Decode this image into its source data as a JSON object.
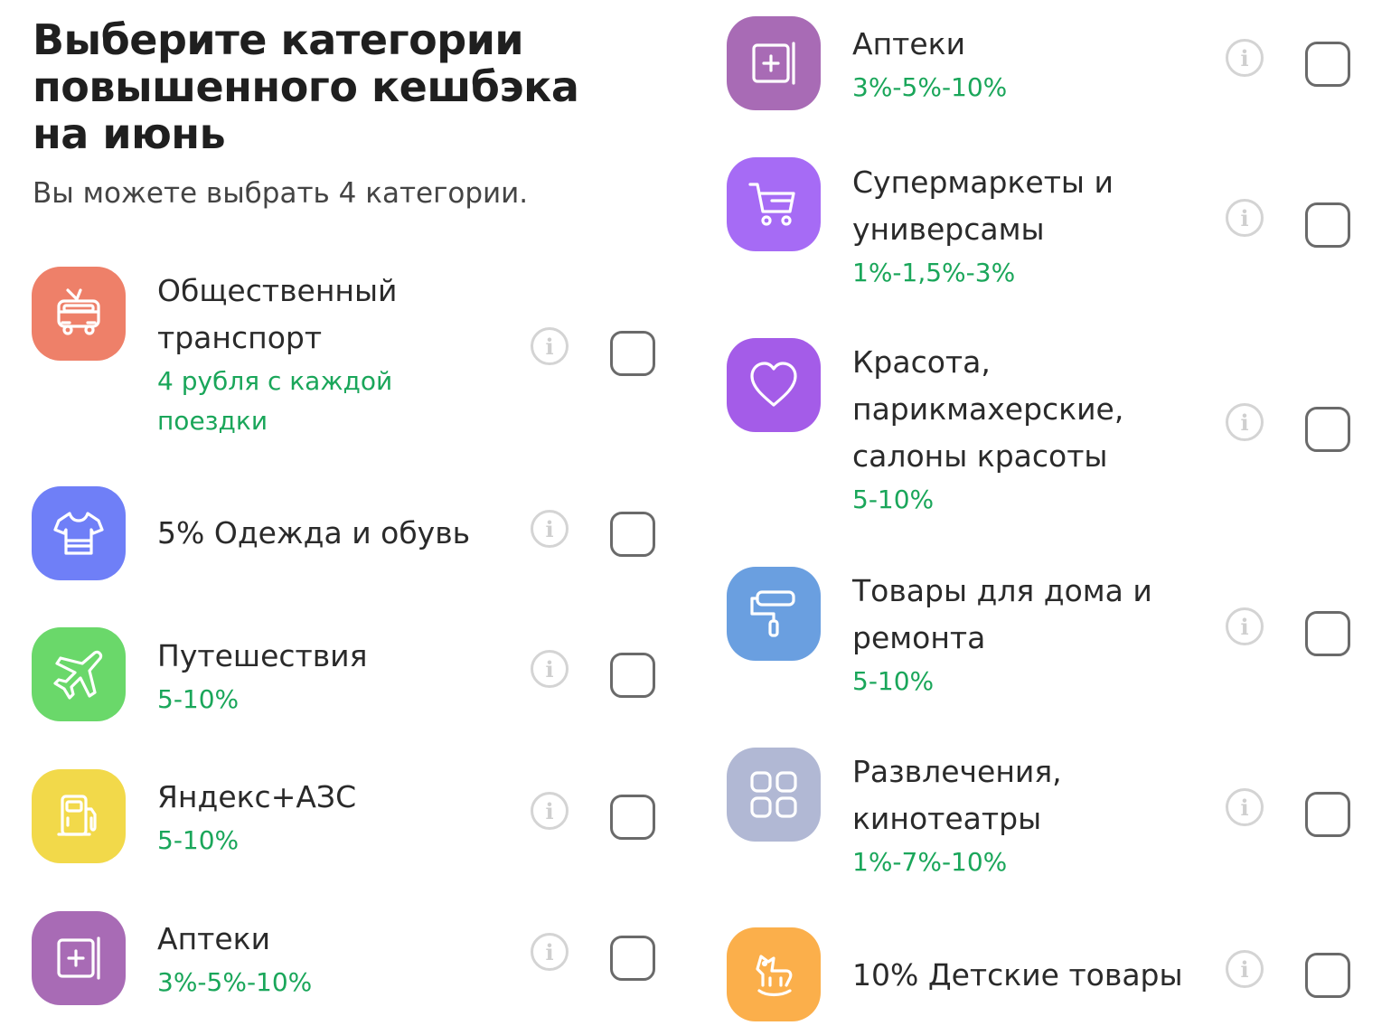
{
  "header": {
    "title": "Выберите категории повышенного кешбэка на июнь",
    "subtitle": "Вы можете выбрать 4 категории."
  },
  "left_items": [
    {
      "name": "Общественный транспорт",
      "rate": "4 рубля с каждой поездки",
      "icon": "trolleybus-icon",
      "color": "#EE8069"
    },
    {
      "name": "5% Одежда и обувь",
      "rate": "",
      "icon": "tshirt-icon",
      "color": "#6F7FF7"
    },
    {
      "name": "Путешествия",
      "rate": "5-10%",
      "icon": "airplane-icon",
      "color": "#6AD86A"
    },
    {
      "name": "Яндекс+АЗС",
      "rate": "5-10%",
      "icon": "fuel-pump-icon",
      "color": "#F2D94A"
    },
    {
      "name": "Аптеки",
      "rate": "3%-5%-10%",
      "icon": "pharmacy-icon",
      "color": "#A86BB5"
    }
  ],
  "right_items": [
    {
      "name": "Аптеки",
      "rate": "3%-5%-10%",
      "icon": "pharmacy-icon",
      "color": "#A86BB5"
    },
    {
      "name": "Супермаркеты и универсамы",
      "rate": "1%-1,5%-3%",
      "icon": "cart-icon",
      "color": "#A66BF5"
    },
    {
      "name": "Красота, парикмахерские, салоны красоты",
      "rate": "5-10%",
      "icon": "heart-icon",
      "color": "#A45CE8"
    },
    {
      "name": "Товары для дома и ремонта",
      "rate": "5-10%",
      "icon": "paint-roller-icon",
      "color": "#6A9FE0"
    },
    {
      "name": "Развлечения, кинотеатры",
      "rate": "1%-7%-10%",
      "icon": "grid-icon",
      "color": "#B1B8D4"
    },
    {
      "name": "10% Детские товары",
      "rate": "",
      "icon": "rocking-horse-icon",
      "color": "#FBAF4B"
    }
  ],
  "info_glyph": "i"
}
